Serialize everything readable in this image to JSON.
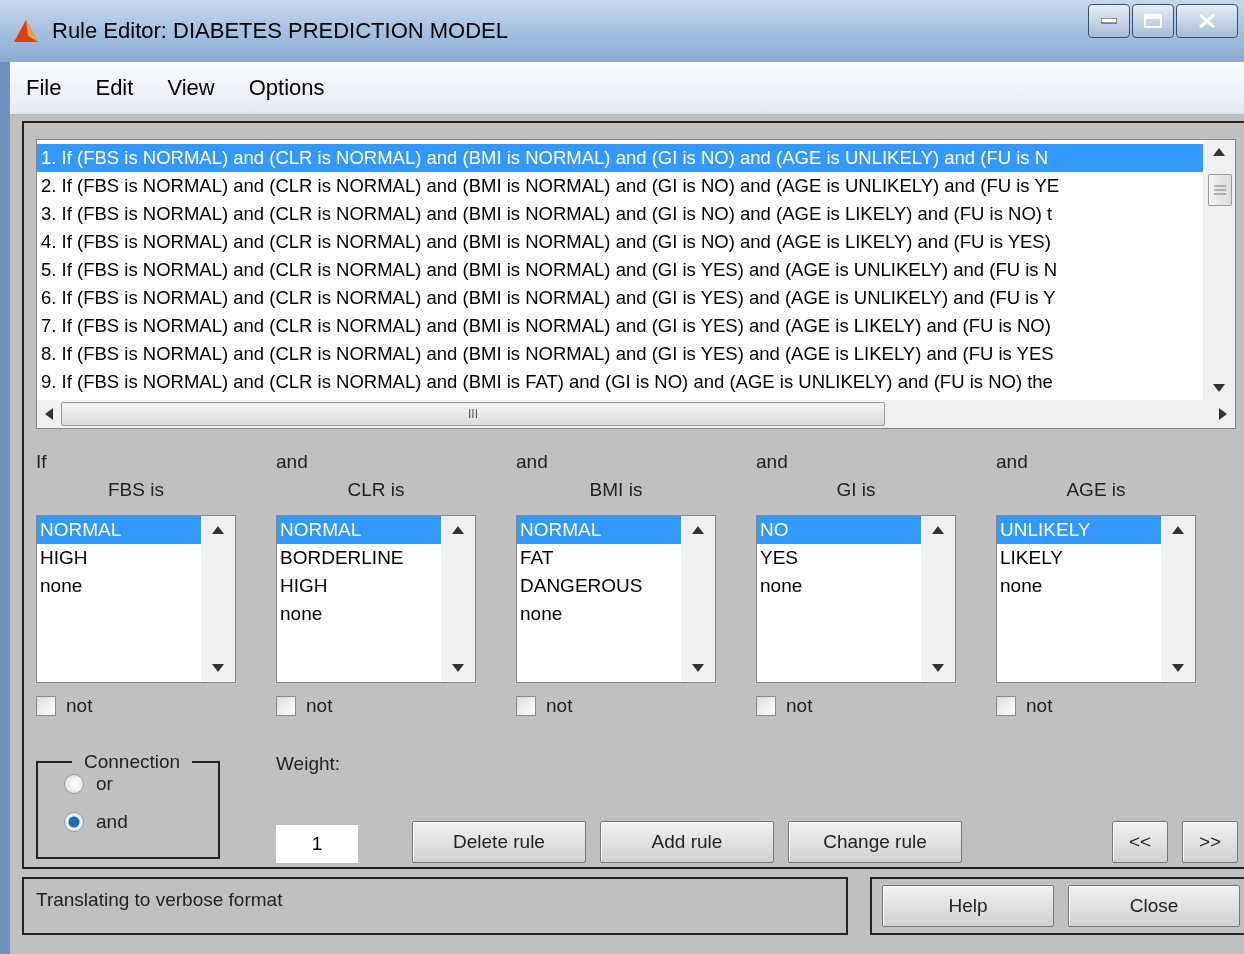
{
  "window": {
    "title": "Rule Editor: DIABETES PREDICTION MODEL"
  },
  "menu": [
    "File",
    "Edit",
    "View",
    "Options"
  ],
  "rules": [
    {
      "text": "1. If (FBS is NORMAL) and (CLR is NORMAL) and (BMI is NORMAL) and (GI is NO) and (AGE is UNLIKELY) and (FU is N",
      "selected": true
    },
    {
      "text": "2. If (FBS is NORMAL) and (CLR is NORMAL) and (BMI is NORMAL) and (GI is NO) and (AGE is UNLIKELY) and (FU is YE",
      "selected": false
    },
    {
      "text": "3. If (FBS is NORMAL) and (CLR is NORMAL) and (BMI is NORMAL) and (GI is NO) and (AGE is LIKELY) and (FU is NO) t",
      "selected": false
    },
    {
      "text": "4. If (FBS is NORMAL) and (CLR is NORMAL) and (BMI is NORMAL) and (GI is NO) and (AGE is LIKELY) and (FU is YES)",
      "selected": false
    },
    {
      "text": "5. If (FBS is NORMAL) and (CLR is NORMAL) and (BMI is NORMAL) and (GI is YES) and (AGE is UNLIKELY) and (FU is N",
      "selected": false
    },
    {
      "text": "6. If (FBS is NORMAL) and (CLR is NORMAL) and (BMI is NORMAL) and (GI is YES) and (AGE is UNLIKELY) and (FU is Y",
      "selected": false
    },
    {
      "text": "7. If (FBS is NORMAL) and (CLR is NORMAL) and (BMI is NORMAL) and (GI is YES) and (AGE is LIKELY) and (FU is NO)",
      "selected": false
    },
    {
      "text": "8. If (FBS is NORMAL) and (CLR is NORMAL) and (BMI is NORMAL) and (GI is YES) and (AGE is LIKELY) and (FU is YES",
      "selected": false
    },
    {
      "text": "9. If (FBS is NORMAL) and (CLR is NORMAL) and (BMI is FAT) and (GI is NO) and (AGE is UNLIKELY) and (FU is NO) the",
      "selected": false
    }
  ],
  "hscroll_grip": "III",
  "columns": [
    {
      "connector": "If",
      "label": "FBS is",
      "options": [
        {
          "label": "NORMAL",
          "selected": true
        },
        {
          "label": "HIGH",
          "selected": false
        },
        {
          "label": "none",
          "selected": false
        }
      ],
      "not_label": "not",
      "not_checked": false
    },
    {
      "connector": "and",
      "label": "CLR is",
      "options": [
        {
          "label": "NORMAL",
          "selected": true
        },
        {
          "label": "BORDERLINE",
          "selected": false
        },
        {
          "label": "HIGH",
          "selected": false
        },
        {
          "label": "none",
          "selected": false
        }
      ],
      "not_label": "not",
      "not_checked": false
    },
    {
      "connector": "and",
      "label": "BMI is",
      "options": [
        {
          "label": "NORMAL",
          "selected": true
        },
        {
          "label": "FAT",
          "selected": false
        },
        {
          "label": "DANGEROUS",
          "selected": false
        },
        {
          "label": "none",
          "selected": false
        }
      ],
      "not_label": "not",
      "not_checked": false
    },
    {
      "connector": "and",
      "label": "GI is",
      "options": [
        {
          "label": "NO",
          "selected": true
        },
        {
          "label": "YES",
          "selected": false
        },
        {
          "label": "none",
          "selected": false
        }
      ],
      "not_label": "not",
      "not_checked": false
    },
    {
      "connector": "and",
      "label": "AGE is",
      "options": [
        {
          "label": "UNLIKELY",
          "selected": true
        },
        {
          "label": "LIKELY",
          "selected": false
        },
        {
          "label": "none",
          "selected": false
        }
      ],
      "not_label": "not",
      "not_checked": false
    }
  ],
  "connection": {
    "label": "Connection",
    "options": [
      {
        "label": "or",
        "selected": false
      },
      {
        "label": "and",
        "selected": true
      }
    ]
  },
  "weight": {
    "label": "Weight:",
    "value": "1"
  },
  "rule_buttons": [
    "Delete rule",
    "Add rule",
    "Change rule"
  ],
  "nav_buttons": [
    "<<",
    ">>"
  ],
  "status": "Translating to verbose format",
  "footer_buttons": [
    "Help",
    "Close"
  ]
}
